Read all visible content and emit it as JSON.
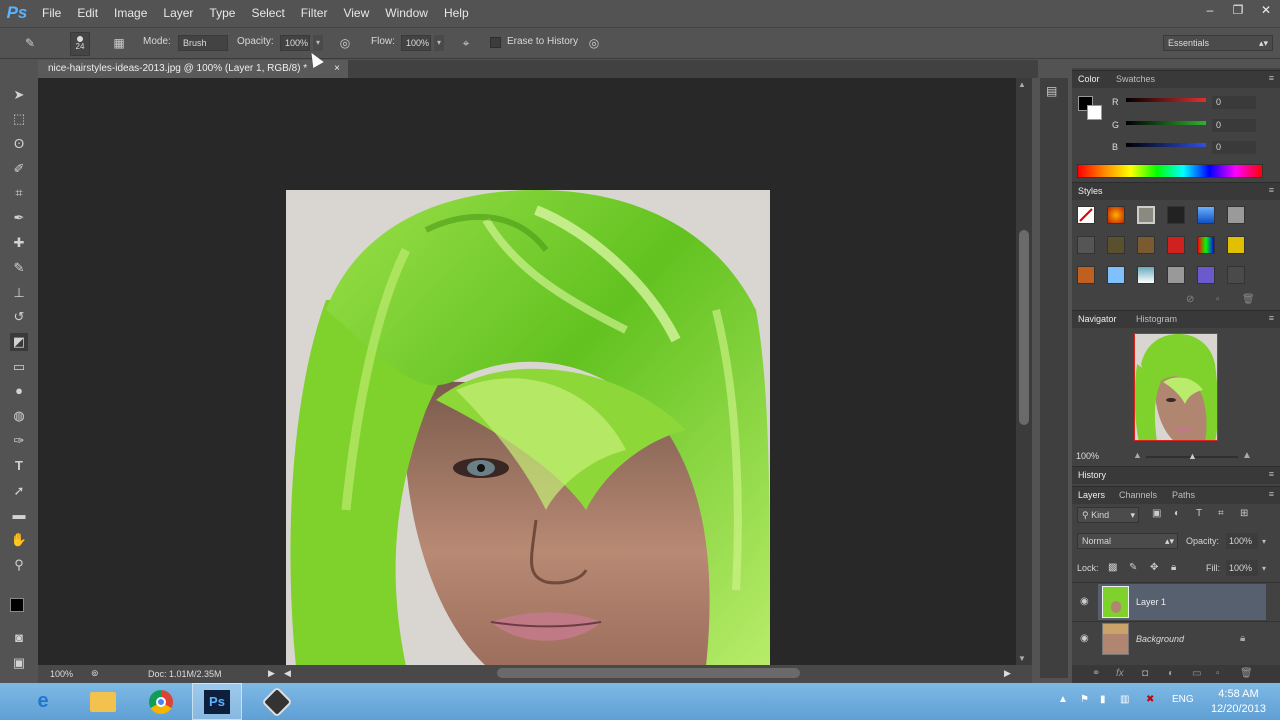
{
  "app": {
    "logo": "Ps"
  },
  "menu": [
    "File",
    "Edit",
    "Image",
    "Layer",
    "Type",
    "Select",
    "Filter",
    "View",
    "Window",
    "Help"
  ],
  "window_controls": {
    "minimize": "–",
    "restore": "❐",
    "close": "✕"
  },
  "options": {
    "brush_size": "24",
    "mode_label": "Mode:",
    "mode_value": "Brush",
    "opacity_label": "Opacity:",
    "opacity_value": "100%",
    "flow_label": "Flow:",
    "flow_value": "100%",
    "erase_history_label": "Erase to History",
    "workspace": "Essentials"
  },
  "document": {
    "tab_title": "nice-hairstyles-ideas-2013.jpg @ 100% (Layer 1, RGB/8) *",
    "close": "×",
    "zoom": "100%",
    "doc_size": "Doc: 1.01M/2.35M"
  },
  "color_panel": {
    "tabs": [
      "Color",
      "Swatches"
    ],
    "channels": [
      {
        "label": "R",
        "value": "0",
        "color": "#e03030"
      },
      {
        "label": "G",
        "value": "0",
        "color": "#30b030"
      },
      {
        "label": "B",
        "value": "0",
        "color": "#3050e0"
      }
    ]
  },
  "styles_panel": {
    "title": "Styles"
  },
  "navigator_panel": {
    "tabs": [
      "Navigator",
      "Histogram"
    ],
    "zoom": "100%"
  },
  "history_panel": {
    "title": "History"
  },
  "layers_panel": {
    "tabs": [
      "Layers",
      "Channels",
      "Paths"
    ],
    "kind_label": "Kind",
    "blend_mode": "Normal",
    "opacity_label": "Opacity:",
    "opacity_value": "100%",
    "lock_label": "Lock:",
    "fill_label": "Fill:",
    "fill_value": "100%",
    "layers": [
      {
        "name": "Layer 1",
        "selected": true
      },
      {
        "name": "Background",
        "selected": false
      }
    ]
  },
  "taskbar": {
    "apps": [
      "ie-icon",
      "explorer-icon",
      "chrome-icon",
      "photoshop-icon",
      "recorder-icon"
    ],
    "ps_label": "Ps",
    "lang": "ENG",
    "time": "4:58 AM",
    "date": "12/20/2013"
  },
  "colors": {
    "hair": "#7fd12c",
    "hair_light": "#c6ef78",
    "skin": "#b08670",
    "accent": "#5ab3ff"
  }
}
